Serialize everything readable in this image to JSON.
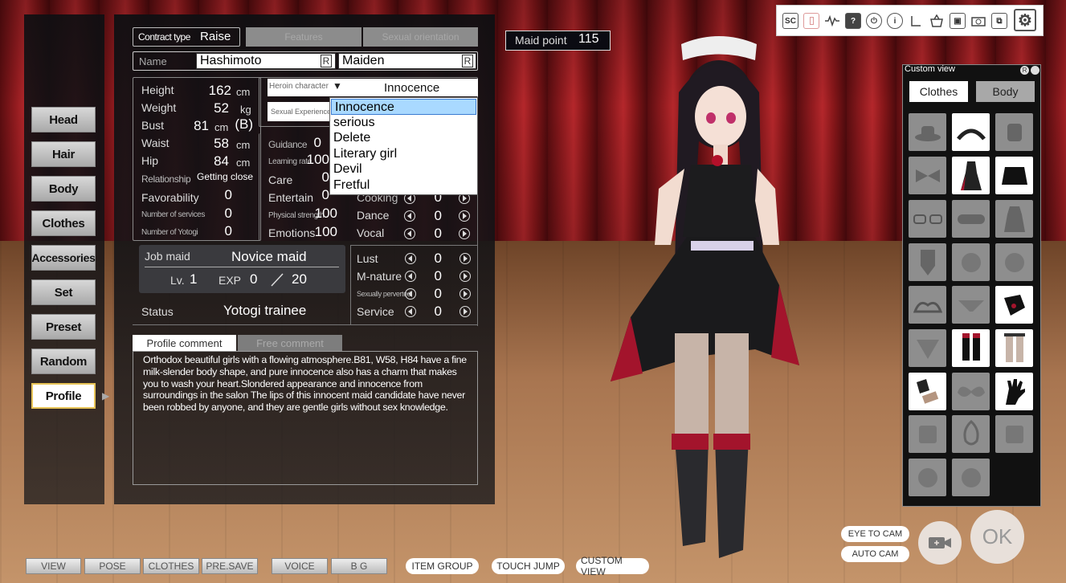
{
  "contract": {
    "label": "Contract type",
    "value": "Raise",
    "tab_features": "Features",
    "tab_sexual": "Sexual orientation"
  },
  "maid_point": {
    "label": "Maid point",
    "value": "115"
  },
  "name": {
    "label": "Name",
    "first": "Hashimoto",
    "last": "Maiden",
    "reset": "R"
  },
  "body_stats": {
    "height": {
      "label": "Height",
      "value": "162",
      "unit": "cm"
    },
    "weight": {
      "label": "Weight",
      "value": "52",
      "unit": "kg"
    },
    "bust": {
      "label": "Bust",
      "value": "81",
      "unit": "cm",
      "cup": "(B)"
    },
    "waist": {
      "label": "Waist",
      "value": "58",
      "unit": "cm"
    },
    "hip": {
      "label": "Hip",
      "value": "84",
      "unit": "cm"
    },
    "relationship": {
      "label": "Relationship",
      "value": "Getting close"
    },
    "favorability": {
      "label": "Favorability",
      "value": "0"
    },
    "services": {
      "label": "Number of services",
      "value": "0"
    },
    "yotogi": {
      "label": "Number of Yotogi",
      "value": "0"
    }
  },
  "heroin": {
    "label": "Heroin character",
    "selected": "Innocence",
    "options": [
      "Innocence",
      "serious",
      "Delete",
      "Literary girl",
      "Devil",
      "Fretful"
    ]
  },
  "sexual_experience": {
    "label": "Sexual Experience"
  },
  "params": {
    "guidance": {
      "label": "Guidance",
      "value": "0"
    },
    "learning": {
      "label": "Learning rate",
      "value": "100"
    },
    "care": {
      "label": "Care",
      "value": "0"
    },
    "entertain": {
      "label": "Entertain",
      "value": "0"
    },
    "physical": {
      "label": "Physical strength",
      "value": "100"
    },
    "emotions": {
      "label": "Emotions",
      "value": "100"
    }
  },
  "skills": {
    "cooking": {
      "label": "Cooking",
      "value": "0"
    },
    "dance": {
      "label": "Dance",
      "value": "0"
    },
    "vocal": {
      "label": "Vocal",
      "value": "0"
    },
    "lust": {
      "label": "Lust",
      "value": "0"
    },
    "mnature": {
      "label": "M-nature",
      "value": "0"
    },
    "perverted": {
      "label": "Sexually perverted",
      "value": "0"
    },
    "service": {
      "label": "Service",
      "value": "0"
    }
  },
  "job": {
    "label": "Job maid",
    "value": "Novice maid",
    "lv_label": "Lv.",
    "lv": "1",
    "exp_label": "EXP",
    "exp": "0",
    "exp_max": "20"
  },
  "status": {
    "label": "Status",
    "value": "Yotogi trainee"
  },
  "comment": {
    "tab_profile": "Profile comment",
    "tab_free": "Free comment",
    "text": "Orthodox beautiful girls with a flowing atmosphere.B81, W58, H84 have a fine milk-slender body shape, and pure innocence also has a charm that makes you to wash your heart.Slondered appearance and innocence from surroundings in the salon The lips of this innocent maid candidate have never been robbed by anyone, and they are gentle girls without sex knowledge."
  },
  "nav": [
    "Head",
    "Hair",
    "Body",
    "Clothes",
    "Accessories",
    "Set",
    "Preset",
    "Random",
    "Profile"
  ],
  "bottom_bar": [
    "VIEW",
    "POSE",
    "CLOTHES",
    "PRE.SAVE",
    "VOICE",
    "B G"
  ],
  "bottom_pills": [
    "ITEM GROUP",
    "TOUCH JUMP",
    "CUSTOM VIEW"
  ],
  "camera": {
    "eye": "EYE TO CAM",
    "auto": "AUTO CAM",
    "ok": "OK"
  },
  "custom_view": {
    "title": "Custom view",
    "tab_clothes": "Clothes",
    "tab_body": "Body",
    "badge": "R"
  },
  "toolbar": {
    "sc": "SC"
  },
  "colors": {
    "accent": "#e7c457",
    "panel": "#141417",
    "highlight": "#a9d9ff"
  }
}
